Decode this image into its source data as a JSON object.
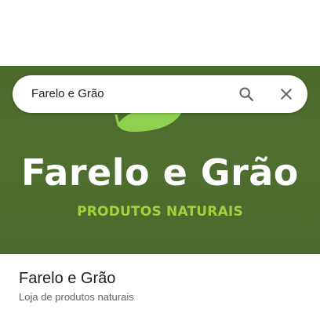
{
  "search": {
    "query": "Farelo e Grão"
  },
  "icons": {
    "search": "search-icon",
    "close": "close-icon"
  },
  "banner": {
    "brand_name": "Farelo e Grão",
    "tagline": "PRODUTOS NATURAIS"
  },
  "place": {
    "title": "Farelo e Grão",
    "subtitle": "Loja de produtos naturais"
  },
  "colors": {
    "banner_background": "#4b6b2d",
    "tagline": "#9fd33d",
    "leaf": "#8fd14f",
    "icon": "#5f6368"
  }
}
